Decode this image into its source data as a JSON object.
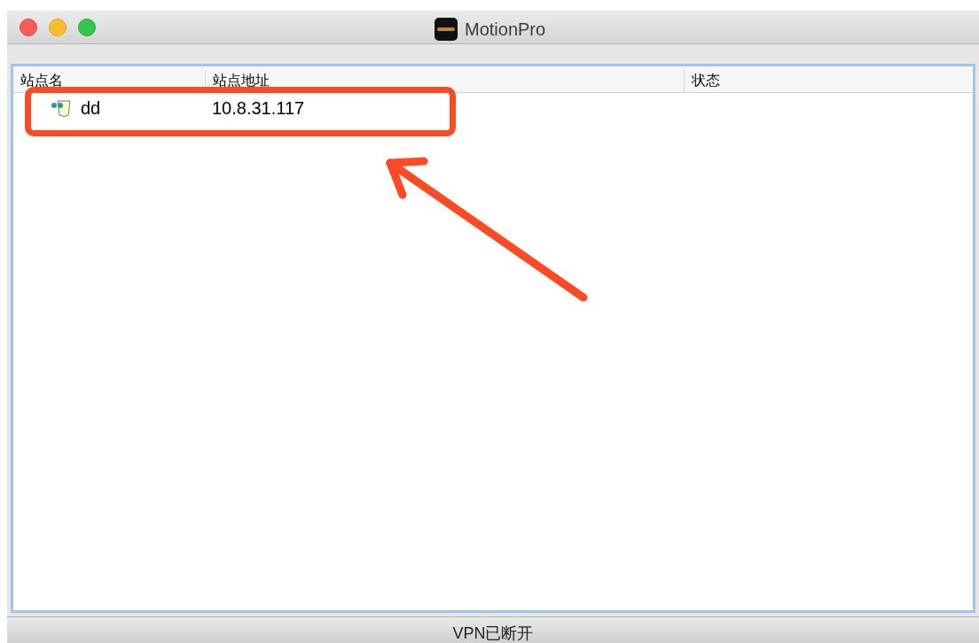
{
  "window": {
    "title": "MotionPro"
  },
  "table": {
    "columns": [
      "站点名",
      "站点地址",
      "状态"
    ],
    "rows": [
      {
        "name": "dd",
        "address": "10.8.31.117"
      }
    ]
  },
  "status_bar": "VPN已断开"
}
